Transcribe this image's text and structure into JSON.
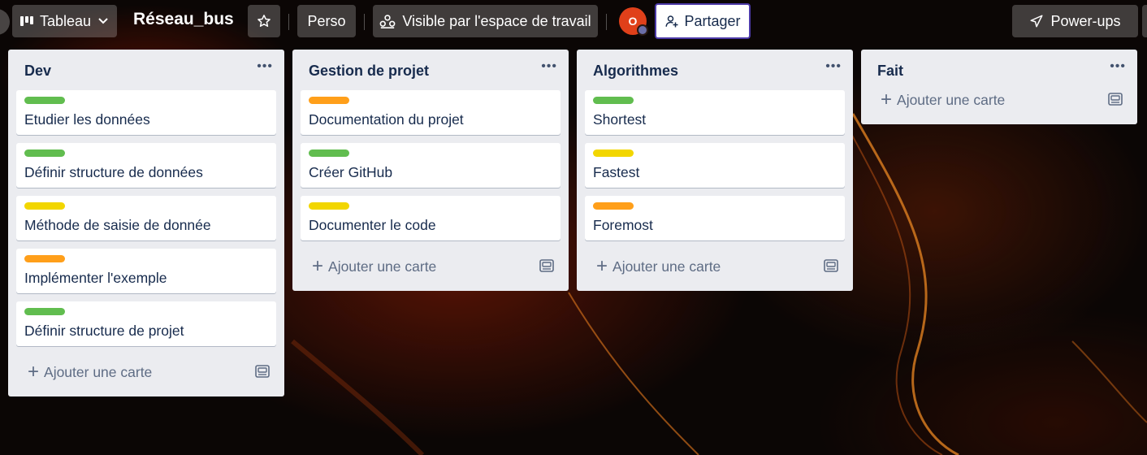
{
  "header": {
    "view_label": "Tableau",
    "board_title": "Réseau_bus",
    "workspace_label": "Perso",
    "visibility_label": "Visible par l'espace de travail",
    "avatar_initial": "O",
    "share_label": "Partager",
    "powerups_label": "Power-ups"
  },
  "colors": {
    "green": "#61bd4f",
    "yellow": "#f2d600",
    "orange": "#ff9f1a"
  },
  "lists": [
    {
      "title": "Dev",
      "cards": [
        {
          "title": "Etudier les données",
          "label": "green"
        },
        {
          "title": "Définir structure de données",
          "label": "green"
        },
        {
          "title": "Méthode de saisie de donnée",
          "label": "yellow"
        },
        {
          "title": "Implémenter l'exemple",
          "label": "orange"
        },
        {
          "title": "Définir structure de projet",
          "label": "green"
        }
      ],
      "add_label": "Ajouter une carte"
    },
    {
      "title": "Gestion de projet",
      "cards": [
        {
          "title": "Documentation du projet",
          "label": "orange"
        },
        {
          "title": "Créer GitHub",
          "label": "green"
        },
        {
          "title": "Documenter le code",
          "label": "yellow"
        }
      ],
      "add_label": "Ajouter une carte"
    },
    {
      "title": "Algorithmes",
      "cards": [
        {
          "title": "Shortest",
          "label": "green"
        },
        {
          "title": "Fastest",
          "label": "yellow"
        },
        {
          "title": "Foremost",
          "label": "orange"
        }
      ],
      "add_label": "Ajouter une carte"
    },
    {
      "title": "Fait",
      "cards": [],
      "add_label": "Ajouter une carte"
    }
  ]
}
